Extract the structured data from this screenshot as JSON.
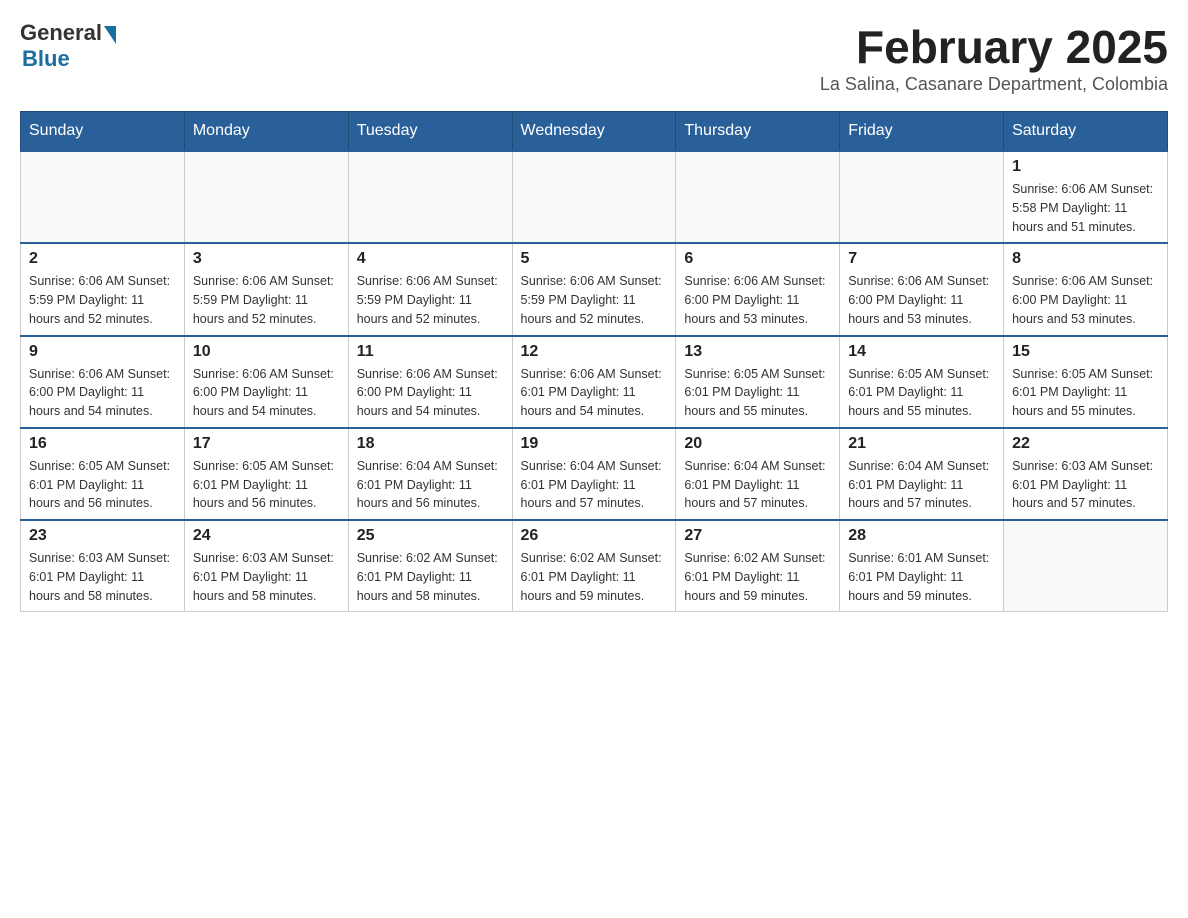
{
  "logo": {
    "general": "General",
    "blue": "Blue"
  },
  "title": "February 2025",
  "subtitle": "La Salina, Casanare Department, Colombia",
  "days_header": [
    "Sunday",
    "Monday",
    "Tuesday",
    "Wednesday",
    "Thursday",
    "Friday",
    "Saturday"
  ],
  "weeks": [
    [
      {
        "day": "",
        "info": ""
      },
      {
        "day": "",
        "info": ""
      },
      {
        "day": "",
        "info": ""
      },
      {
        "day": "",
        "info": ""
      },
      {
        "day": "",
        "info": ""
      },
      {
        "day": "",
        "info": ""
      },
      {
        "day": "1",
        "info": "Sunrise: 6:06 AM\nSunset: 5:58 PM\nDaylight: 11 hours and 51 minutes."
      }
    ],
    [
      {
        "day": "2",
        "info": "Sunrise: 6:06 AM\nSunset: 5:59 PM\nDaylight: 11 hours and 52 minutes."
      },
      {
        "day": "3",
        "info": "Sunrise: 6:06 AM\nSunset: 5:59 PM\nDaylight: 11 hours and 52 minutes."
      },
      {
        "day": "4",
        "info": "Sunrise: 6:06 AM\nSunset: 5:59 PM\nDaylight: 11 hours and 52 minutes."
      },
      {
        "day": "5",
        "info": "Sunrise: 6:06 AM\nSunset: 5:59 PM\nDaylight: 11 hours and 52 minutes."
      },
      {
        "day": "6",
        "info": "Sunrise: 6:06 AM\nSunset: 6:00 PM\nDaylight: 11 hours and 53 minutes."
      },
      {
        "day": "7",
        "info": "Sunrise: 6:06 AM\nSunset: 6:00 PM\nDaylight: 11 hours and 53 minutes."
      },
      {
        "day": "8",
        "info": "Sunrise: 6:06 AM\nSunset: 6:00 PM\nDaylight: 11 hours and 53 minutes."
      }
    ],
    [
      {
        "day": "9",
        "info": "Sunrise: 6:06 AM\nSunset: 6:00 PM\nDaylight: 11 hours and 54 minutes."
      },
      {
        "day": "10",
        "info": "Sunrise: 6:06 AM\nSunset: 6:00 PM\nDaylight: 11 hours and 54 minutes."
      },
      {
        "day": "11",
        "info": "Sunrise: 6:06 AM\nSunset: 6:00 PM\nDaylight: 11 hours and 54 minutes."
      },
      {
        "day": "12",
        "info": "Sunrise: 6:06 AM\nSunset: 6:01 PM\nDaylight: 11 hours and 54 minutes."
      },
      {
        "day": "13",
        "info": "Sunrise: 6:05 AM\nSunset: 6:01 PM\nDaylight: 11 hours and 55 minutes."
      },
      {
        "day": "14",
        "info": "Sunrise: 6:05 AM\nSunset: 6:01 PM\nDaylight: 11 hours and 55 minutes."
      },
      {
        "day": "15",
        "info": "Sunrise: 6:05 AM\nSunset: 6:01 PM\nDaylight: 11 hours and 55 minutes."
      }
    ],
    [
      {
        "day": "16",
        "info": "Sunrise: 6:05 AM\nSunset: 6:01 PM\nDaylight: 11 hours and 56 minutes."
      },
      {
        "day": "17",
        "info": "Sunrise: 6:05 AM\nSunset: 6:01 PM\nDaylight: 11 hours and 56 minutes."
      },
      {
        "day": "18",
        "info": "Sunrise: 6:04 AM\nSunset: 6:01 PM\nDaylight: 11 hours and 56 minutes."
      },
      {
        "day": "19",
        "info": "Sunrise: 6:04 AM\nSunset: 6:01 PM\nDaylight: 11 hours and 57 minutes."
      },
      {
        "day": "20",
        "info": "Sunrise: 6:04 AM\nSunset: 6:01 PM\nDaylight: 11 hours and 57 minutes."
      },
      {
        "day": "21",
        "info": "Sunrise: 6:04 AM\nSunset: 6:01 PM\nDaylight: 11 hours and 57 minutes."
      },
      {
        "day": "22",
        "info": "Sunrise: 6:03 AM\nSunset: 6:01 PM\nDaylight: 11 hours and 57 minutes."
      }
    ],
    [
      {
        "day": "23",
        "info": "Sunrise: 6:03 AM\nSunset: 6:01 PM\nDaylight: 11 hours and 58 minutes."
      },
      {
        "day": "24",
        "info": "Sunrise: 6:03 AM\nSunset: 6:01 PM\nDaylight: 11 hours and 58 minutes."
      },
      {
        "day": "25",
        "info": "Sunrise: 6:02 AM\nSunset: 6:01 PM\nDaylight: 11 hours and 58 minutes."
      },
      {
        "day": "26",
        "info": "Sunrise: 6:02 AM\nSunset: 6:01 PM\nDaylight: 11 hours and 59 minutes."
      },
      {
        "day": "27",
        "info": "Sunrise: 6:02 AM\nSunset: 6:01 PM\nDaylight: 11 hours and 59 minutes."
      },
      {
        "day": "28",
        "info": "Sunrise: 6:01 AM\nSunset: 6:01 PM\nDaylight: 11 hours and 59 minutes."
      },
      {
        "day": "",
        "info": ""
      }
    ]
  ]
}
